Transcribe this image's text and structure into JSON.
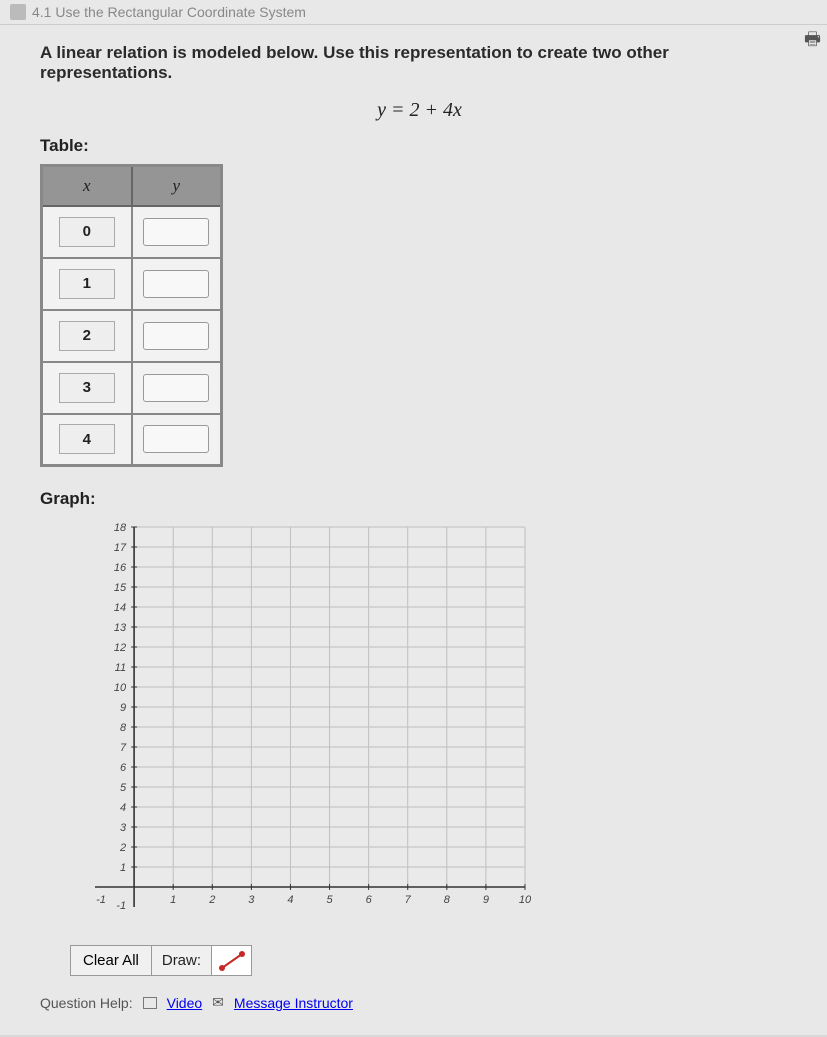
{
  "breadcrumb": {
    "section": "4.1 Use the Rectangular Coordinate System"
  },
  "instruction": "A linear relation is modeled below. Use this representation to create two other representations.",
  "equation": "y = 2 + 4x",
  "labels": {
    "table": "Table:",
    "graph": "Graph:",
    "x_header": "x",
    "y_header": "y",
    "clear_all": "Clear All",
    "draw": "Draw:",
    "question_help": "Question Help:",
    "video": "Video",
    "message_instructor": "Message Instructor"
  },
  "table_rows": [
    {
      "x": "0",
      "y": ""
    },
    {
      "x": "1",
      "y": ""
    },
    {
      "x": "2",
      "y": ""
    },
    {
      "x": "3",
      "y": ""
    },
    {
      "x": "4",
      "y": ""
    }
  ],
  "chart_data": {
    "type": "scatter",
    "title": "",
    "xlabel": "",
    "ylabel": "",
    "xlim": [
      -1,
      10
    ],
    "ylim": [
      -1,
      18
    ],
    "x_ticks": [
      1,
      2,
      3,
      4,
      5,
      6,
      7,
      8,
      9,
      10
    ],
    "y_ticks": [
      1,
      2,
      3,
      4,
      5,
      6,
      7,
      8,
      9,
      10,
      11,
      12,
      13,
      14,
      15,
      16,
      17,
      18
    ],
    "grid": true,
    "series": []
  }
}
